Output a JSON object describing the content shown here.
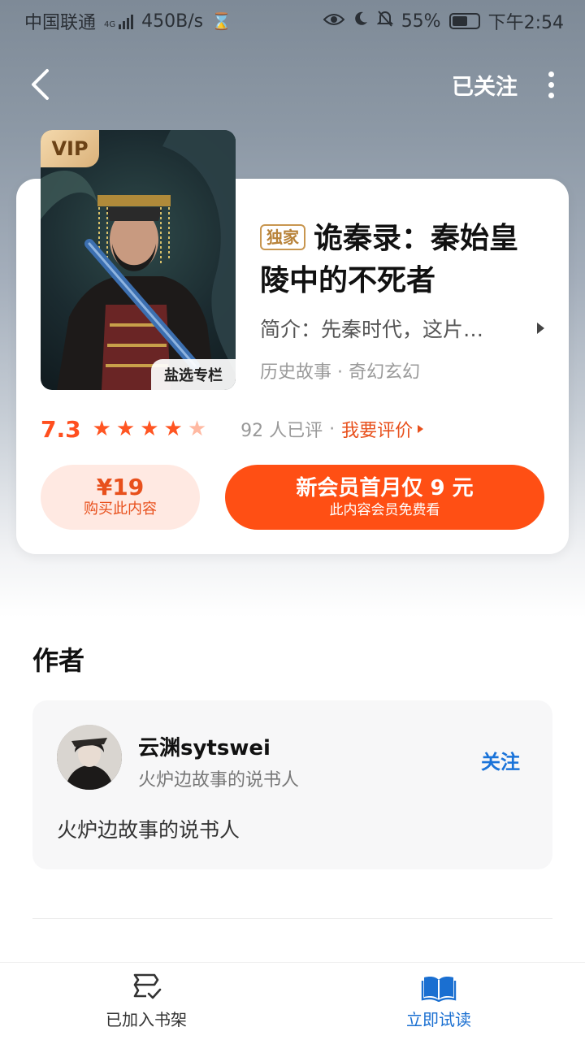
{
  "status_bar": {
    "carrier": "中国联通",
    "net_type": "4G",
    "speed": "450B/s",
    "battery": "55%",
    "time": "下午2:54"
  },
  "nav": {
    "followed_label": "已关注"
  },
  "book": {
    "vip_badge": "VIP",
    "column_badge": "盐选专栏",
    "exclusive_tag": "独家",
    "title": "诡秦录：秦始皇陵中的不死者",
    "intro": "简介：先秦时代，这片…",
    "tags": "历史故事 · 奇幻玄幻",
    "rating": {
      "score": "7.3",
      "stars_filled": 4,
      "stars_total": 5,
      "rated_count": "92 人已评",
      "separator": "·",
      "rate_link": "我要评价"
    },
    "buy": {
      "price": "¥19",
      "label": "购买此内容"
    },
    "membership": {
      "main": "新会员首月仅 9 元",
      "sub": "此内容会员免费看"
    }
  },
  "author_section": {
    "title": "作者",
    "name": "云渊sytswei",
    "tagline": "火炉边故事的说书人",
    "follow_label": "关注",
    "description": "火炉边故事的说书人"
  },
  "bottom_bar": {
    "shelf_label": "已加入书架",
    "read_label": "立即试读",
    "active_color": "#1a6fd1"
  },
  "colors": {
    "accent": "#ff4f14",
    "link_blue": "#1a73d9",
    "vip_gold": "#dbb27a"
  }
}
